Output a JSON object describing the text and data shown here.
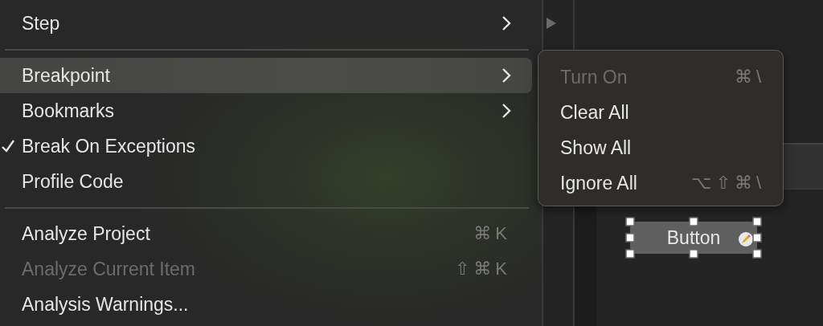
{
  "menu": {
    "items": [
      {
        "kind": "item",
        "label": "Step",
        "submenu": true,
        "selected": false,
        "checked": false,
        "disabled": false
      },
      {
        "kind": "separator"
      },
      {
        "kind": "item",
        "label": "Breakpoint",
        "submenu": true,
        "selected": true,
        "checked": false,
        "disabled": false
      },
      {
        "kind": "item",
        "label": "Bookmarks",
        "submenu": true,
        "selected": false,
        "checked": false,
        "disabled": false
      },
      {
        "kind": "item",
        "label": "Break On Exceptions",
        "submenu": false,
        "selected": false,
        "checked": true,
        "disabled": false
      },
      {
        "kind": "item",
        "label": "Profile Code",
        "submenu": false,
        "selected": false,
        "checked": false,
        "disabled": false
      },
      {
        "kind": "separator"
      },
      {
        "kind": "item",
        "label": "Analyze Project",
        "shortcut": "⌘K",
        "submenu": false,
        "selected": false,
        "checked": false,
        "disabled": false
      },
      {
        "kind": "item",
        "label": "Analyze Current Item",
        "shortcut": "⇧⌘K",
        "submenu": false,
        "selected": false,
        "checked": false,
        "disabled": true
      },
      {
        "kind": "item",
        "label": "Analysis Warnings...",
        "submenu": false,
        "selected": false,
        "checked": false,
        "disabled": false
      }
    ]
  },
  "submenu": {
    "items": [
      {
        "label": "Turn On",
        "shortcut": "⌘\\",
        "disabled": true
      },
      {
        "label": "Clear All",
        "disabled": false
      },
      {
        "label": "Show All",
        "disabled": false
      },
      {
        "label": "Ignore All",
        "shortcut": "⌥⇧⌘\\",
        "disabled": false
      }
    ]
  },
  "canvas_button": {
    "label": "Button",
    "selected": true
  }
}
